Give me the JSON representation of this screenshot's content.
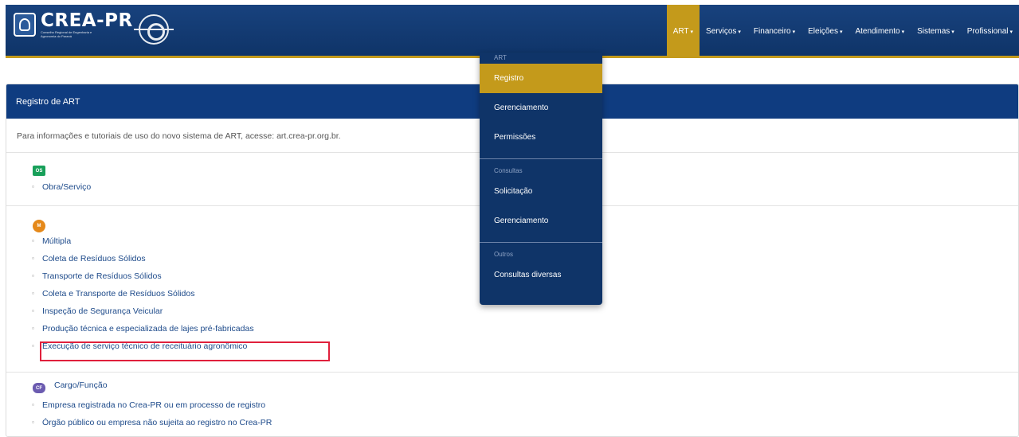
{
  "brand": {
    "title": "CREA-PR",
    "subtitle": "Conselho Regional de Engenharia e Agronomia do Paraná"
  },
  "nav": {
    "items": [
      {
        "label": "ART",
        "active": true
      },
      {
        "label": "Serviços"
      },
      {
        "label": "Financeiro"
      },
      {
        "label": "Eleições"
      },
      {
        "label": "Atendimento"
      },
      {
        "label": "Sistemas"
      },
      {
        "label": "Profissional"
      }
    ]
  },
  "dropdown": {
    "group1_header": "ART",
    "group1": [
      "Registro",
      "Gerenciamento",
      "Permissões"
    ],
    "group2_header": "Consultas",
    "group2": [
      "Solicitação",
      "Gerenciamento"
    ],
    "group3_header": "Outros",
    "group3": [
      "Consultas diversas"
    ]
  },
  "panel": {
    "title": "Registro de ART",
    "info": "Para informações e tutoriais de uso do novo sistema de ART, acesse: art.crea-pr.org.br."
  },
  "sections": {
    "os": {
      "badge": "OS",
      "items": [
        "Obra/Serviço"
      ]
    },
    "m": {
      "badge": "M",
      "items": [
        "Múltipla",
        "Coleta de Resíduos Sólidos",
        "Transporte de Resíduos Sólidos",
        "Coleta e Transporte de Resíduos Sólidos",
        "Inspeção de Segurança Veicular",
        "Produção técnica e especializada de lajes pré-fabricadas",
        "Execução de serviço técnico de receituário agronômico"
      ]
    },
    "cf": {
      "badge": "CF",
      "label": "Cargo/Função",
      "items": [
        "Empresa registrada no Crea-PR ou em processo de registro",
        "Órgão público ou empresa não sujeita ao registro no Crea-PR"
      ]
    }
  },
  "colors": {
    "navbar": "#0f3468",
    "accent": "#c49a1b",
    "highlight": "#e0203c"
  }
}
